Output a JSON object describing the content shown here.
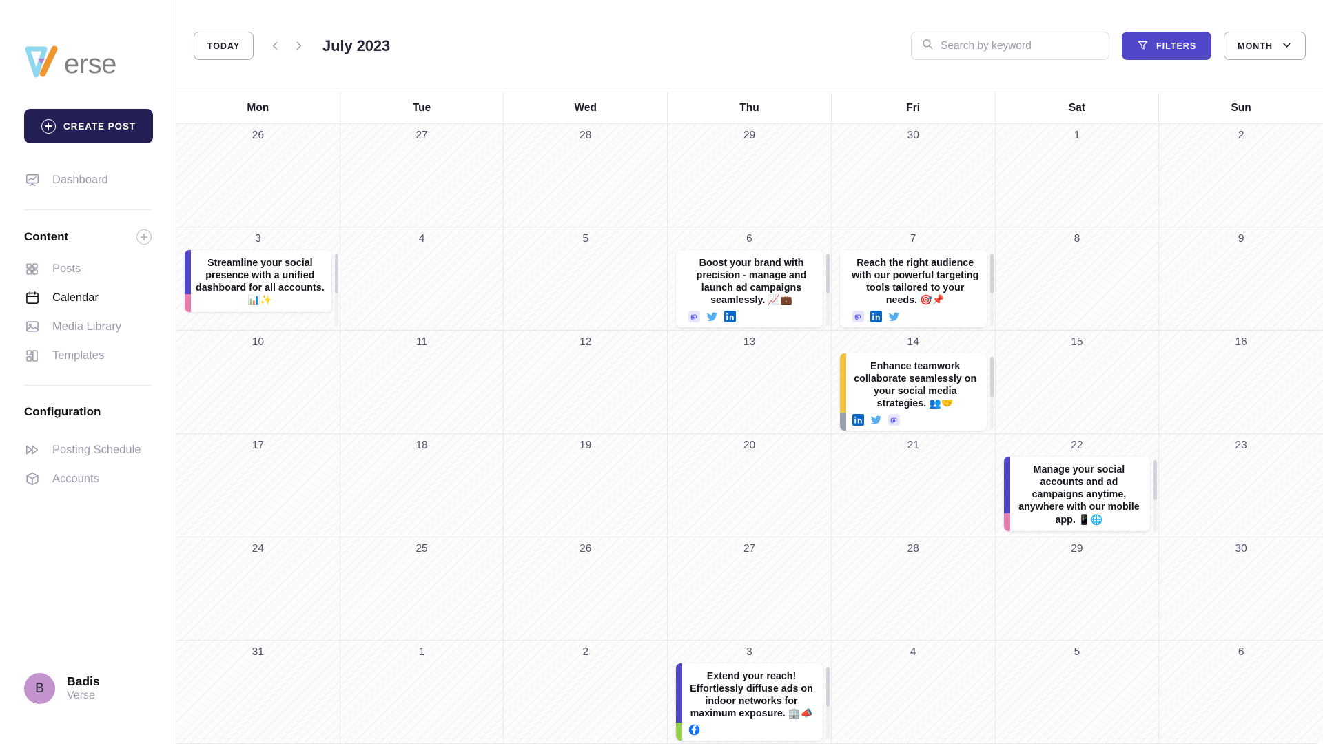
{
  "brand": {
    "logo_text": "erse",
    "logo_colors": {
      "blue": "#8ed8ef",
      "orange": "#f0962f",
      "violet": "#b07fd0",
      "text": "#808080"
    }
  },
  "sidebar": {
    "create_post_label": "CREATE POST",
    "primary_items": [
      {
        "label": "Dashboard",
        "icon": "dashboard-icon",
        "active": false
      }
    ],
    "content_section": {
      "title": "Content",
      "add_icon": "plus-circle-icon"
    },
    "content_items": [
      {
        "label": "Posts",
        "icon": "grid-icon",
        "active": false
      },
      {
        "label": "Calendar",
        "icon": "calendar-icon",
        "active": true
      },
      {
        "label": "Media Library",
        "icon": "image-icon",
        "active": false
      },
      {
        "label": "Templates",
        "icon": "templates-icon",
        "active": false
      }
    ],
    "configuration_section": {
      "title": "Configuration"
    },
    "configuration_items": [
      {
        "label": "Posting Schedule",
        "icon": "fast-forward-icon",
        "active": false
      },
      {
        "label": "Accounts",
        "icon": "box-icon",
        "active": false
      }
    ],
    "user": {
      "initial": "B",
      "name": "Badis",
      "org": "Verse",
      "avatar_color": "#c393ce"
    }
  },
  "toolbar": {
    "today_label": "TODAY",
    "prev_icon": "chevron-left-icon",
    "next_icon": "chevron-right-icon",
    "month_title": "July 2023",
    "search": {
      "placeholder": "Search by keyword",
      "value": "",
      "icon": "search-icon"
    },
    "filters_label": "FILTERS",
    "filters_icon": "funnel-icon",
    "filters_color": "#5046c8",
    "view_label": "MONTH",
    "view_caret_icon": "chevron-down-icon"
  },
  "calendar": {
    "day_headers": [
      "Mon",
      "Tue",
      "Wed",
      "Thu",
      "Fri",
      "Sat",
      "Sun"
    ],
    "weeks": [
      {
        "days": [
          {
            "num": "26",
            "posts": []
          },
          {
            "num": "27",
            "posts": []
          },
          {
            "num": "28",
            "posts": []
          },
          {
            "num": "29",
            "posts": []
          },
          {
            "num": "30",
            "posts": []
          },
          {
            "num": "1",
            "posts": []
          },
          {
            "num": "2",
            "posts": []
          }
        ]
      },
      {
        "days": [
          {
            "num": "3",
            "posts": [
              {
                "text": "Streamline your social presence with a unified dashboard for all accounts. 📊✨",
                "accent_top": "#5046c8",
                "accent_bottom": "#e87bae",
                "channels": []
              }
            ],
            "scrollbar": true
          },
          {
            "num": "4",
            "posts": []
          },
          {
            "num": "5",
            "posts": []
          },
          {
            "num": "6",
            "posts": [
              {
                "text": "Boost your brand with precision - manage and launch ad campaigns seamlessly. 📈💼",
                "accent_top": "#ffffff",
                "accent_bottom": "#ffffff",
                "channels": [
                  "mastodon",
                  "twitter",
                  "linkedin"
                ]
              }
            ],
            "scrollbar": true
          },
          {
            "num": "7",
            "posts": [
              {
                "text": "Reach the right audience with our powerful targeting tools tailored to your needs. 🎯📌",
                "accent_top": "#ffffff",
                "accent_bottom": "#ffffff",
                "channels": [
                  "mastodon",
                  "linkedin",
                  "twitter"
                ]
              }
            ],
            "scrollbar": true
          },
          {
            "num": "8",
            "posts": []
          },
          {
            "num": "9",
            "posts": []
          }
        ]
      },
      {
        "days": [
          {
            "num": "10",
            "posts": []
          },
          {
            "num": "11",
            "posts": []
          },
          {
            "num": "12",
            "posts": []
          },
          {
            "num": "13",
            "posts": []
          },
          {
            "num": "14",
            "posts": [
              {
                "text": "Enhance teamwork collaborate seamlessly on your social media strategies. 👥🤝",
                "accent_top": "#f0c040",
                "accent_bottom": "#97a0ad",
                "channels": [
                  "linkedin",
                  "twitter",
                  "mastodon"
                ]
              }
            ],
            "scrollbar": true
          },
          {
            "num": "15",
            "posts": []
          },
          {
            "num": "16",
            "posts": []
          }
        ]
      },
      {
        "days": [
          {
            "num": "17",
            "posts": []
          },
          {
            "num": "18",
            "posts": []
          },
          {
            "num": "19",
            "posts": []
          },
          {
            "num": "20",
            "posts": []
          },
          {
            "num": "21",
            "posts": []
          },
          {
            "num": "22",
            "posts": [
              {
                "text": "Manage your social accounts and ad campaigns anytime, anywhere with our mobile app. 📱🌐",
                "accent_top": "#5046c8",
                "accent_bottom": "#e87bae",
                "channels": []
              }
            ],
            "scrollbar": true
          },
          {
            "num": "23",
            "posts": []
          }
        ]
      },
      {
        "days": [
          {
            "num": "24",
            "posts": []
          },
          {
            "num": "25",
            "posts": []
          },
          {
            "num": "26",
            "posts": []
          },
          {
            "num": "27",
            "posts": []
          },
          {
            "num": "28",
            "posts": []
          },
          {
            "num": "29",
            "posts": []
          },
          {
            "num": "30",
            "posts": []
          }
        ]
      },
      {
        "days": [
          {
            "num": "31",
            "posts": []
          },
          {
            "num": "1",
            "posts": []
          },
          {
            "num": "2",
            "posts": []
          },
          {
            "num": "3",
            "posts": [
              {
                "text": "Extend your reach! Effortlessly diffuse ads on indoor networks for maximum exposure. 🏢📣",
                "accent_top": "#5046c8",
                "accent_bottom": "#95d04a",
                "channels": [
                  "facebook"
                ]
              }
            ],
            "scrollbar": true
          },
          {
            "num": "4",
            "posts": []
          },
          {
            "num": "5",
            "posts": []
          },
          {
            "num": "6",
            "posts": []
          }
        ]
      }
    ]
  }
}
